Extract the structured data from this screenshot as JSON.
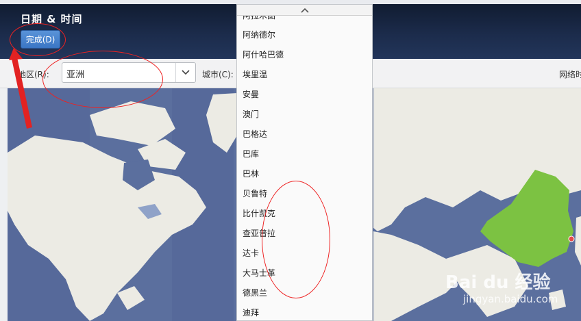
{
  "header": {
    "title": "日期 & 时间",
    "done_label": "完成(D)"
  },
  "toolbar": {
    "region_label": "地区(R):",
    "region_value": "亚洲",
    "city_label": "城市(C):",
    "ntp_label": "网络时"
  },
  "city_dropdown": {
    "partial_top_item": "阿拉木图",
    "items": [
      "阿纳德尔",
      "阿什哈巴德",
      "埃里温",
      "安曼",
      "澳门",
      "巴格达",
      "巴库",
      "巴林",
      "贝鲁特",
      "比什凯克",
      "查亚普拉",
      "达卡",
      "大马士革",
      "德黑兰",
      "迪拜"
    ]
  },
  "watermark": {
    "text": "Bai du 经验",
    "sub": "jingyan.baidu.com"
  },
  "colors": {
    "header_bg": "#1c2c4c",
    "button_bg": "#3a76c5",
    "ocean": "#5b6f9e",
    "land": "#ecebe4",
    "selected_region": "#7cc242",
    "annotation": "#e22222"
  },
  "icons": {
    "region_dropdown": "chevron-down-icon",
    "list_scroll_up": "chevron-up-icon",
    "timezone_marker": "location-pin-icon"
  }
}
